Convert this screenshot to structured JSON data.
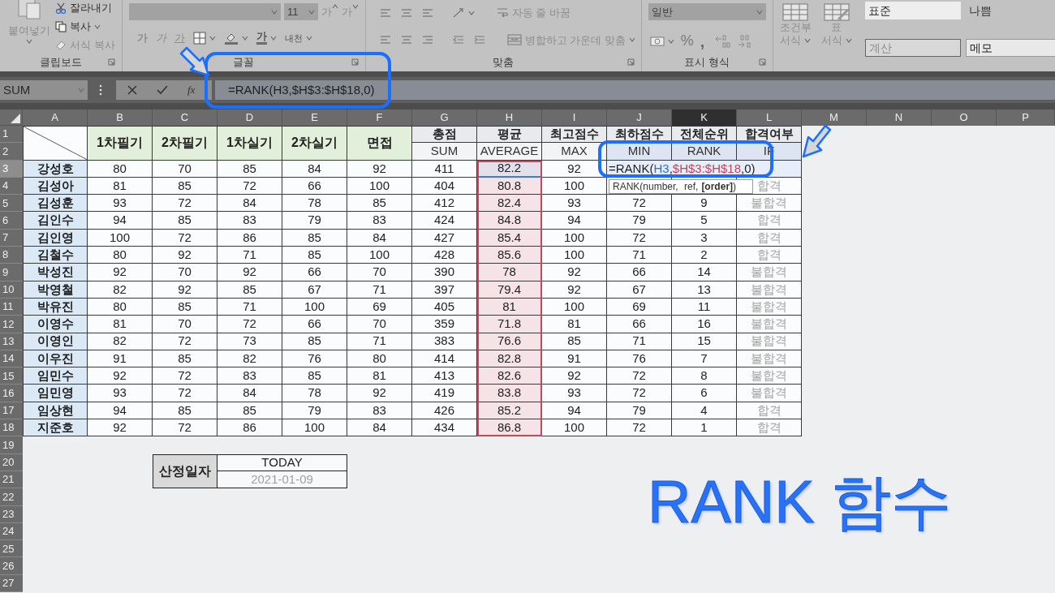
{
  "ribbon": {
    "groups": [
      {
        "kind": "clipboard",
        "label": "클립보드",
        "paste": "붙여넣기",
        "commands": [
          "잘라내기",
          "복사",
          "서식 복사"
        ]
      },
      {
        "kind": "font",
        "label": "글꼴",
        "size": "11",
        "grow": "가",
        "shrink": "가",
        "styles": [
          "가",
          "가",
          "가"
        ],
        "font_color": "가",
        "phonetic": "내천"
      },
      {
        "kind": "alignment",
        "label": "맞춤",
        "wrap": "자동 줄 바꿈",
        "merge": "병합하고 가운데 맞춤"
      },
      {
        "kind": "number",
        "label": "표시 형식",
        "format": "일반",
        "percent": "%",
        "comma": ","
      },
      {
        "kind": "styles",
        "buttons": [
          {
            "lines": [
              "조건부",
              "서식"
            ]
          },
          {
            "lines": [
              "표",
              "서식"
            ]
          }
        ],
        "cell_styles": [
          {
            "label": "표준",
            "kind": "normal"
          },
          {
            "label": "나쁨",
            "kind": "bad"
          },
          {
            "label": "계산",
            "kind": "calc"
          },
          {
            "label": "메모",
            "kind": "note"
          }
        ]
      }
    ]
  },
  "formula_bar": {
    "name_box": "SUM",
    "fx": "fx",
    "formula": "=RANK(H3,$H$3:$H$18,0)"
  },
  "sheet": {
    "columns": [
      {
        "label": "A",
        "selected": false
      },
      {
        "label": "B",
        "selected": false
      },
      {
        "label": "C",
        "selected": false
      },
      {
        "label": "D",
        "selected": false
      },
      {
        "label": "E",
        "selected": false
      },
      {
        "label": "F",
        "selected": false
      },
      {
        "label": "G",
        "selected": false
      },
      {
        "label": "H",
        "selected": false
      },
      {
        "label": "I",
        "selected": false
      },
      {
        "label": "J",
        "selected": false
      },
      {
        "label": "K",
        "selected": true
      },
      {
        "label": "L",
        "selected": false
      },
      {
        "label": "M",
        "selected": false
      },
      {
        "label": "N",
        "selected": false
      },
      {
        "label": "O",
        "selected": false
      },
      {
        "label": "P",
        "selected": false
      }
    ],
    "rows": [
      {
        "label": "1",
        "selected": false
      },
      {
        "label": "2",
        "selected": false
      },
      {
        "label": "3",
        "selected": true
      },
      {
        "label": "4",
        "selected": false
      },
      {
        "label": "5",
        "selected": false
      },
      {
        "label": "6",
        "selected": false
      },
      {
        "label": "7",
        "selected": false
      },
      {
        "label": "8",
        "selected": false
      },
      {
        "label": "9",
        "selected": false
      },
      {
        "label": "10",
        "selected": false
      },
      {
        "label": "11",
        "selected": false
      },
      {
        "label": "12",
        "selected": false
      },
      {
        "label": "13",
        "selected": false
      },
      {
        "label": "14",
        "selected": false
      },
      {
        "label": "15",
        "selected": false
      },
      {
        "label": "16",
        "selected": false
      },
      {
        "label": "17",
        "selected": false
      },
      {
        "label": "18",
        "selected": false
      },
      {
        "label": "19",
        "selected": false
      },
      {
        "label": "20",
        "selected": false
      },
      {
        "label": "21",
        "selected": false
      },
      {
        "label": "22",
        "selected": false
      },
      {
        "label": "23",
        "selected": false
      },
      {
        "label": "24",
        "selected": false
      },
      {
        "label": "25",
        "selected": false
      },
      {
        "label": "26",
        "selected": false
      },
      {
        "label": "27",
        "selected": false
      }
    ],
    "table": {
      "score_headers": [
        "1차필기",
        "2차필기",
        "1차실기",
        "2차실기",
        "면접"
      ],
      "calc_headers": [
        {
          "label": "총점",
          "function": "SUM"
        },
        {
          "label": "평균",
          "function": "AVERAGE"
        },
        {
          "label": "최고점수",
          "function": "MAX"
        },
        {
          "label": "최하점수",
          "function": "MIN"
        },
        {
          "label": "전체순위",
          "function": "RANK"
        },
        {
          "label": "합격여부",
          "function": "IF"
        }
      ],
      "records": [
        {
          "name": "강성호",
          "scores": [
            "80",
            "70",
            "85",
            "84",
            "92"
          ],
          "total": "411",
          "average": "82.2",
          "max": "92",
          "formula_parts": [
            {
              "text": "=RANK(",
              "kind": "plain"
            },
            {
              "text": "H3",
              "kind": "reference",
              "color": "#2e6fd1"
            },
            {
              "text": ",",
              "kind": "plain"
            },
            {
              "text": "$H$3:$H$18",
              "kind": "reference",
              "color": "#c0455a"
            },
            {
              "text": ",0)",
              "kind": "plain"
            }
          ],
          "tooltip": "RANK(number, ref, **[order]**)"
        },
        {
          "name": "김성아",
          "scores": [
            "81",
            "85",
            "72",
            "66",
            "100"
          ],
          "total": "404",
          "average": "80.8",
          "max": "100",
          "result": "합격"
        },
        {
          "name": "김성훈",
          "scores": [
            "93",
            "72",
            "84",
            "78",
            "85"
          ],
          "total": "412",
          "average": "82.4",
          "max": "93",
          "min": "72",
          "rank": "9",
          "result": "불합격"
        },
        {
          "name": "김인수",
          "scores": [
            "94",
            "85",
            "83",
            "79",
            "83"
          ],
          "total": "424",
          "average": "84.8",
          "max": "94",
          "min": "79",
          "rank": "5",
          "result": "합격"
        },
        {
          "name": "김인영",
          "scores": [
            "100",
            "72",
            "86",
            "85",
            "84"
          ],
          "total": "427",
          "average": "85.4",
          "max": "100",
          "min": "72",
          "rank": "3",
          "result": "합격"
        },
        {
          "name": "김철수",
          "scores": [
            "80",
            "92",
            "71",
            "85",
            "100"
          ],
          "total": "428",
          "average": "85.6",
          "max": "100",
          "min": "71",
          "rank": "2",
          "result": "합격"
        },
        {
          "name": "박성진",
          "scores": [
            "92",
            "70",
            "92",
            "66",
            "70"
          ],
          "total": "390",
          "average": "78",
          "max": "92",
          "min": "66",
          "rank": "14",
          "result": "불합격"
        },
        {
          "name": "박영철",
          "scores": [
            "82",
            "92",
            "85",
            "67",
            "71"
          ],
          "total": "397",
          "average": "79.4",
          "max": "92",
          "min": "67",
          "rank": "13",
          "result": "불합격"
        },
        {
          "name": "박유진",
          "scores": [
            "80",
            "85",
            "71",
            "100",
            "69"
          ],
          "total": "405",
          "average": "81",
          "max": "100",
          "min": "69",
          "rank": "11",
          "result": "불합격"
        },
        {
          "name": "이영수",
          "scores": [
            "81",
            "70",
            "72",
            "66",
            "70"
          ],
          "total": "359",
          "average": "71.8",
          "max": "81",
          "min": "66",
          "rank": "16",
          "result": "불합격"
        },
        {
          "name": "이영인",
          "scores": [
            "82",
            "72",
            "73",
            "85",
            "71"
          ],
          "total": "383",
          "average": "76.6",
          "max": "85",
          "min": "71",
          "rank": "15",
          "result": "불합격"
        },
        {
          "name": "이우진",
          "scores": [
            "91",
            "85",
            "82",
            "76",
            "80"
          ],
          "total": "414",
          "average": "82.8",
          "max": "91",
          "min": "76",
          "rank": "7",
          "result": "불합격"
        },
        {
          "name": "임민수",
          "scores": [
            "92",
            "72",
            "83",
            "85",
            "81"
          ],
          "total": "413",
          "average": "82.6",
          "max": "92",
          "min": "72",
          "rank": "8",
          "result": "불합격"
        },
        {
          "name": "임민영",
          "scores": [
            "93",
            "72",
            "84",
            "78",
            "92"
          ],
          "total": "419",
          "average": "83.8",
          "max": "93",
          "min": "72",
          "rank": "6",
          "result": "불합격"
        },
        {
          "name": "임상현",
          "scores": [
            "94",
            "85",
            "85",
            "79",
            "83"
          ],
          "total": "426",
          "average": "85.2",
          "max": "94",
          "min": "79",
          "rank": "4",
          "result": "합격"
        },
        {
          "name": "지준호",
          "scores": [
            "92",
            "72",
            "86",
            "100",
            "84"
          ],
          "total": "434",
          "average": "86.8",
          "max": "100",
          "min": "72",
          "rank": "1",
          "result": "합격"
        }
      ]
    },
    "summary": {
      "label": "산정일자",
      "function": "TODAY",
      "value": "2021-01-09"
    }
  },
  "title": "RANK 함수"
}
